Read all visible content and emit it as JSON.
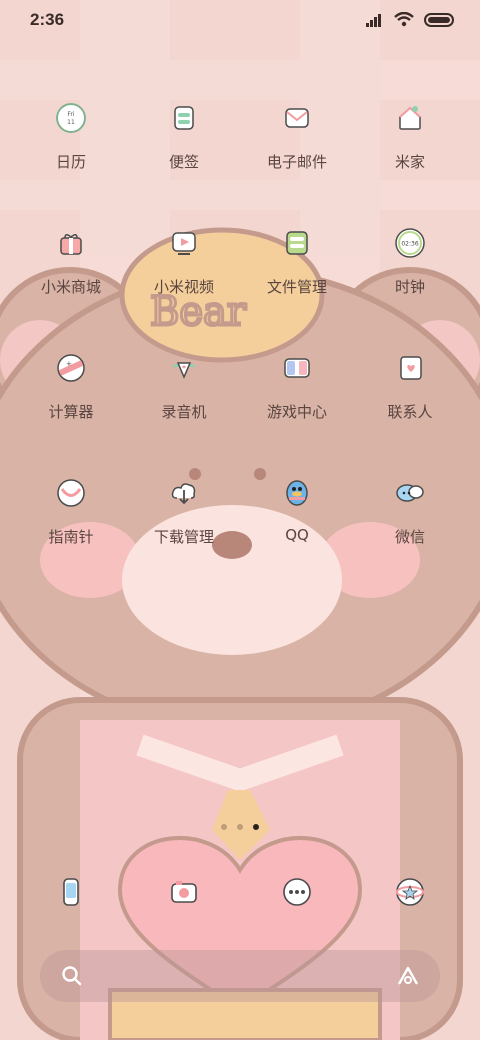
{
  "status": {
    "time": "2:36"
  },
  "apps": [
    {
      "label": "日历",
      "icon": "calendar-icon",
      "icon_text": "Fri\n11"
    },
    {
      "label": "便签",
      "icon": "notes-icon"
    },
    {
      "label": "电子邮件",
      "icon": "email-icon"
    },
    {
      "label": "米家",
      "icon": "home-icon"
    },
    {
      "label": "小米商城",
      "icon": "store-icon"
    },
    {
      "label": "小米视频",
      "icon": "video-icon"
    },
    {
      "label": "文件管理",
      "icon": "files-icon"
    },
    {
      "label": "时钟",
      "icon": "clock-icon",
      "icon_text": "02:36"
    },
    {
      "label": "计算器",
      "icon": "calculator-icon"
    },
    {
      "label": "录音机",
      "icon": "recorder-icon"
    },
    {
      "label": "游戏中心",
      "icon": "game-icon"
    },
    {
      "label": "联系人",
      "icon": "contacts-icon"
    },
    {
      "label": "指南针",
      "icon": "compass-icon"
    },
    {
      "label": "下载管理",
      "icon": "download-icon"
    },
    {
      "label": "QQ",
      "icon": "qq-icon"
    },
    {
      "label": "微信",
      "icon": "wechat-icon"
    }
  ],
  "calendar_icon": {
    "day": "Fri",
    "date": "11"
  },
  "clock_icon": {
    "time": "02:36"
  },
  "page_indicator": {
    "pages": 3,
    "current": 3
  },
  "dock": [
    {
      "icon": "phone-icon"
    },
    {
      "icon": "camera-icon"
    },
    {
      "icon": "messages-icon"
    },
    {
      "icon": "browser-icon"
    }
  ],
  "colors": {
    "wallpaper": "#f3d6cf",
    "bear": "#d8b3a6",
    "label": "#5a4540"
  }
}
